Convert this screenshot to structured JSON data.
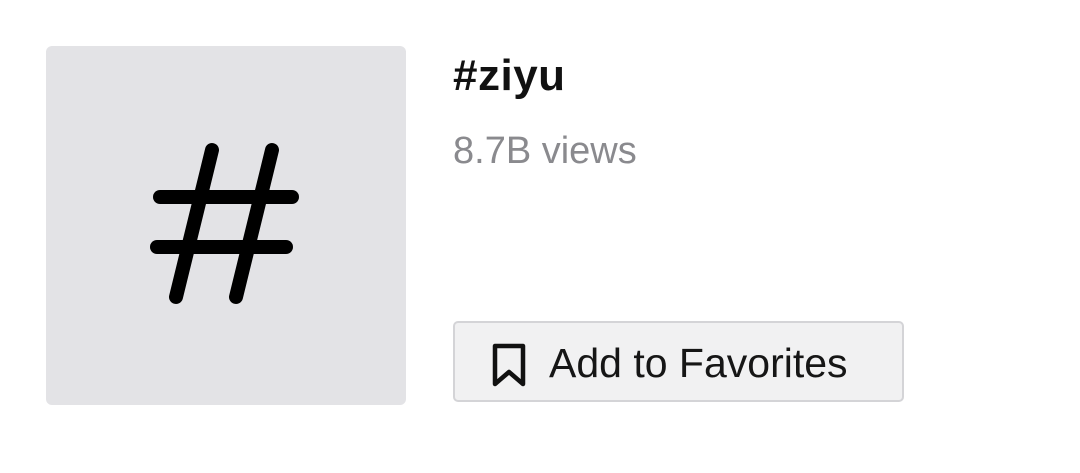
{
  "hashtag": {
    "thumbnail_icon": "hash-icon",
    "title": "#ziyu",
    "views": "8.7B views"
  },
  "actions": {
    "favorite_icon": "bookmark-icon",
    "favorite_label": "Add to Favorites"
  },
  "colors": {
    "thumbnail_bg": "#e3e3e6",
    "views_text": "#8a8a8e",
    "button_bg": "#f1f1f2",
    "button_border": "#d4d4d7"
  }
}
